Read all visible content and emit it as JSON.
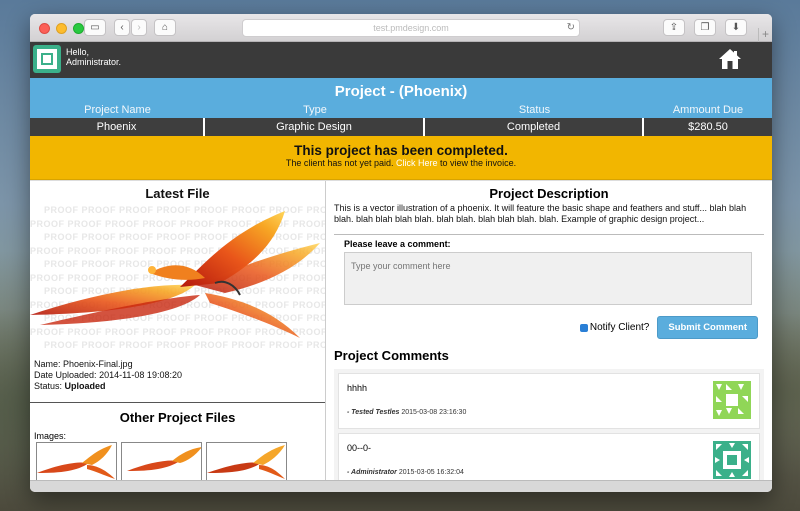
{
  "browser": {
    "address": "test.pmdesign.com",
    "new_tab": "+"
  },
  "header": {
    "greeting_line1": "Hello,",
    "greeting_line2": "Administrator."
  },
  "project": {
    "title": "Project - (Phoenix)",
    "columns": [
      "Project Name",
      "Type",
      "Status",
      "Ammount Due"
    ],
    "values": [
      "Phoenix",
      "Graphic Design",
      "Completed",
      "$280.50"
    ]
  },
  "banner": {
    "title": "This project has been completed.",
    "sub_before": "The client has not yet paid.",
    "link": "Click Here",
    "sub_after": "to view the invoice."
  },
  "latest_file": {
    "heading": "Latest File",
    "watermark": "PROOF",
    "name_label": "Name:",
    "name": "Phoenix-Final.jpg",
    "date_label": "Date Uploaded:",
    "date": "2014-11-08 19:08:20",
    "status_label": "Status:",
    "status": "Uploaded"
  },
  "other_files": {
    "heading": "Other Project Files",
    "images_label": "Images:"
  },
  "description": {
    "heading": "Project Description",
    "text": "This is a vector illustration of a phoenix. It will feature the basic shape and feathers and stuff... blah blah blah. blah blah blah blah. blah blah. blah blah blah. blah. Example of graphic design project..."
  },
  "comment_form": {
    "label": "Please leave a comment:",
    "placeholder": "Type your comment here",
    "notify_label": "Notify Client?",
    "notify_checked": true,
    "submit_label": "Submit Comment"
  },
  "comments": {
    "heading": "Project Comments",
    "items": [
      {
        "text": "hhhh",
        "author": "- Tested Testles",
        "time": "2015-03-08 23:16:30",
        "avatar_color": "#7ccf3a"
      },
      {
        "text": "00--0-",
        "author": "- Administrator",
        "time": "2015-03-05 16:32:04",
        "avatar_color": "#3bb08a"
      }
    ]
  },
  "colors": {
    "accent": "#5aaddd",
    "banner": "#f2b600",
    "dark": "#3a3a3a"
  }
}
